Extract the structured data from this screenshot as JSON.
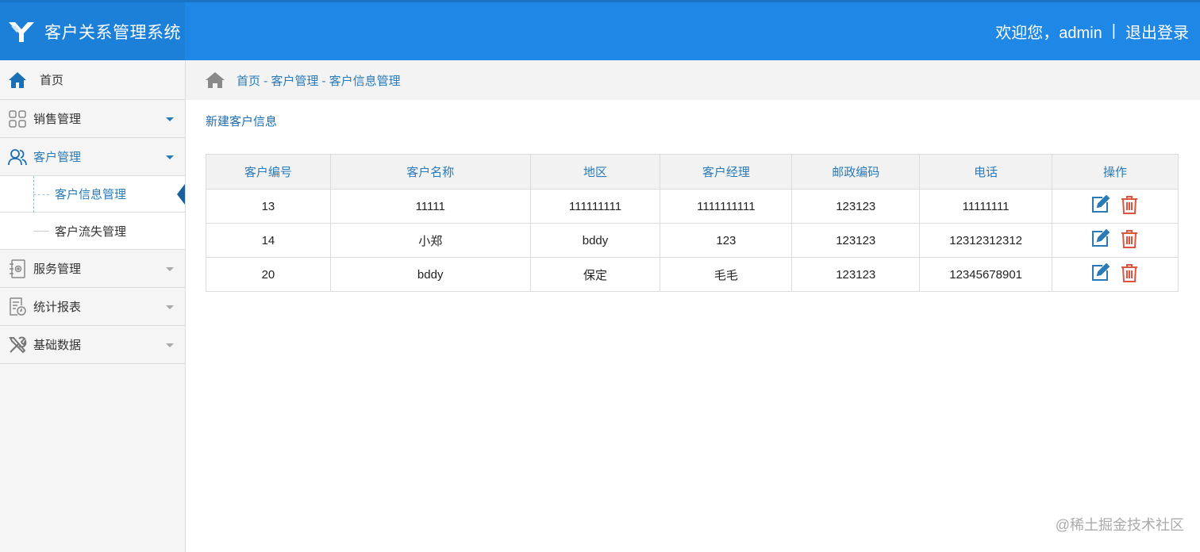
{
  "header": {
    "app_title": "客户关系管理系统",
    "welcome": "欢迎您，admin",
    "separator": "|",
    "logout": "退出登录"
  },
  "sidebar": {
    "home": "首页",
    "items": [
      {
        "label": "销售管理",
        "icon": "grid-icon"
      },
      {
        "label": "客户管理",
        "icon": "users-icon"
      },
      {
        "label": "服务管理",
        "icon": "service-icon"
      },
      {
        "label": "统计报表",
        "icon": "report-icon"
      },
      {
        "label": "基础数据",
        "icon": "tools-icon"
      }
    ],
    "submenu": [
      {
        "label": "客户信息管理"
      },
      {
        "label": "客户流失管理"
      }
    ]
  },
  "breadcrumb": {
    "text": "首页 - 客户管理 - 客户信息管理"
  },
  "main": {
    "new_link": "新建客户信息",
    "columns": [
      "客户编号",
      "客户名称",
      "地区",
      "客户经理",
      "邮政编码",
      "电话",
      "操作"
    ],
    "rows": [
      [
        "13",
        "11111",
        "111111111",
        "1111111111",
        "123123",
        "11111111"
      ],
      [
        "14",
        "小郑",
        "bddy",
        "123",
        "123123",
        "12312312312"
      ],
      [
        "20",
        "bddy",
        "保定",
        "毛毛",
        "123123",
        "12345678901"
      ]
    ]
  },
  "colors": {
    "header_bg": "#1f87e5",
    "accent": "#2a7ab8",
    "delete": "#e0533f"
  },
  "watermark": "@稀土掘金技术社区"
}
